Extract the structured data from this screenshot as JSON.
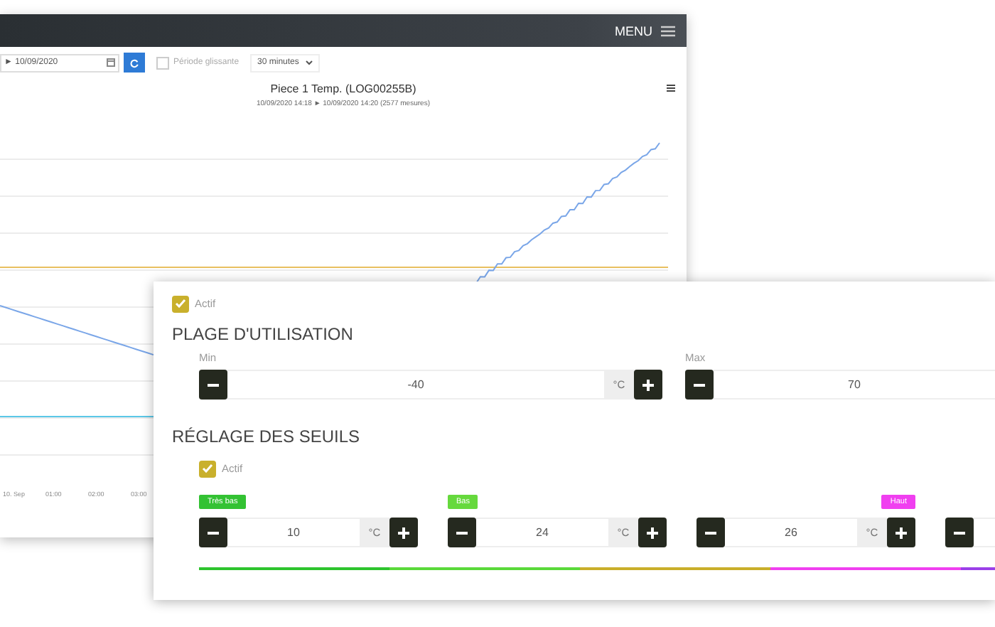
{
  "background_app": {
    "header": {
      "menu_label": "MENU"
    },
    "toolbar": {
      "date_range": "► 10/09/2020",
      "sliding_period": {
        "label": "Période glissante",
        "checked": false
      },
      "interval": "30 minutes"
    },
    "chart": {
      "title": "Piece 1 Temp. (LOG00255B)",
      "subtitle": "10/09/2020 14:18 ► 10/09/2020 14:20 (2577 mesures)",
      "x_labels": [
        "10. Sep",
        "01:00",
        "02:00",
        "03:00"
      ]
    }
  },
  "settings": {
    "usage_range": {
      "active": {
        "label": "Actif",
        "checked": true
      },
      "title": "PLAGE D'UTILISATION",
      "fields": [
        {
          "label": "Min",
          "value": "-40",
          "unit": "°C"
        },
        {
          "label": "Max",
          "value": "70"
        }
      ]
    },
    "thresholds": {
      "title": "RÉGLAGE DES SEUILS",
      "active": {
        "label": "Actif",
        "checked": true
      },
      "levels": [
        {
          "kind": "tag_left",
          "label": "Très bas",
          "color": "#33c233",
          "value": "10",
          "unit": "°C"
        },
        {
          "kind": "tag_left",
          "label": "Bas",
          "color": "#66d93d",
          "value": "24",
          "unit": "°C"
        },
        {
          "kind": "tag_right",
          "label": "Haut",
          "color": "#f03ff0",
          "value": "26",
          "unit": "°C"
        },
        {
          "kind": "partial"
        }
      ],
      "scale": [
        {
          "color": "#2ec42e"
        },
        {
          "color": "#5ad93a"
        },
        {
          "color": "#c9ae2a"
        },
        {
          "color": "#f03ff0"
        },
        {
          "color": "#9b3fe8"
        }
      ]
    }
  }
}
